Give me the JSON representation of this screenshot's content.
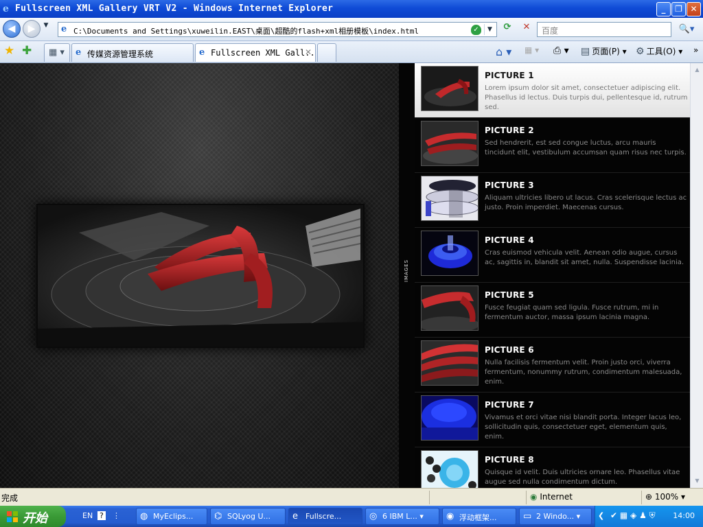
{
  "window": {
    "title": "Fullscreen XML Gallery VRT V2 - Windows Internet Explorer",
    "minimize": "_",
    "restore": "❐",
    "close": "✕"
  },
  "nav": {
    "back": "◀",
    "forward": "▶",
    "address": "C:\\Documents and Settings\\xuweilin.EAST\\桌面\\超酷的flash+xml相册模板\\index.html",
    "search_placeholder": "百度",
    "refresh": "⟳",
    "stop": "✕",
    "search_go": "🔍▾"
  },
  "tabs": [
    {
      "label": "传媒资源管理系统"
    },
    {
      "label": "Fullscreen XML Gall..."
    }
  ],
  "toolbar": {
    "home": "⌂",
    "feeds": "▦",
    "print": "⎙",
    "page_label": "页面(P)",
    "tools_label": "工具(O)",
    "more": "»"
  },
  "gallery": {
    "side_tab_label": "IMAGES",
    "items": [
      {
        "title": "PICTURE 1",
        "desc": "Lorem ipsum dolor sit amet, consectetuer adipiscing elit. Phasellus id lectus. Duis turpis dui, pellentesque id, rutrum sed."
      },
      {
        "title": "PICTURE 2",
        "desc": "Sed hendrerit, est sed congue luctus, arcu mauris tincidunt elit, vestibulum accumsan quam risus nec turpis."
      },
      {
        "title": "PICTURE 3",
        "desc": "Aliquam ultricies libero ut lacus. Cras scelerisque lectus ac justo. Proin imperdiet. Maecenas cursus."
      },
      {
        "title": "PICTURE 4",
        "desc": "Cras euismod vehicula velit. Aenean odio augue, cursus ac, sagittis in, blandit sit amet, nulla. Suspendisse lacinia."
      },
      {
        "title": "PICTURE 5",
        "desc": "Fusce feugiat quam sed ligula. Fusce rutrum, mi in fermentum auctor, massa ipsum lacinia magna."
      },
      {
        "title": "PICTURE 6",
        "desc": "Nulla facilisis fermentum velit. Proin justo orci, viverra fermentum, nonummy rutrum, condimentum malesuada, enim."
      },
      {
        "title": "PICTURE 7",
        "desc": "Vivamus et orci vitae nisi blandit porta. Integer lacus leo, sollicitudin quis, consectetuer eget, elementum quis, enim."
      },
      {
        "title": "PICTURE 8",
        "desc": "Quisque id velit. Duis ultricies ornare leo. Phasellus vitae augue sed nulla condimentum dictum."
      }
    ]
  },
  "status": {
    "text": "完成",
    "zone": "Internet",
    "zoom": "100%"
  },
  "taskbar": {
    "start": "开始",
    "lang": "EN",
    "items": [
      {
        "label": "MyEclips..."
      },
      {
        "label": "SQLyog U..."
      },
      {
        "label": "Fullscre..."
      },
      {
        "label": "6 IBM L..."
      },
      {
        "label": "浮动框架..."
      },
      {
        "label": "2 Windo..."
      }
    ],
    "clock": "14:00"
  }
}
